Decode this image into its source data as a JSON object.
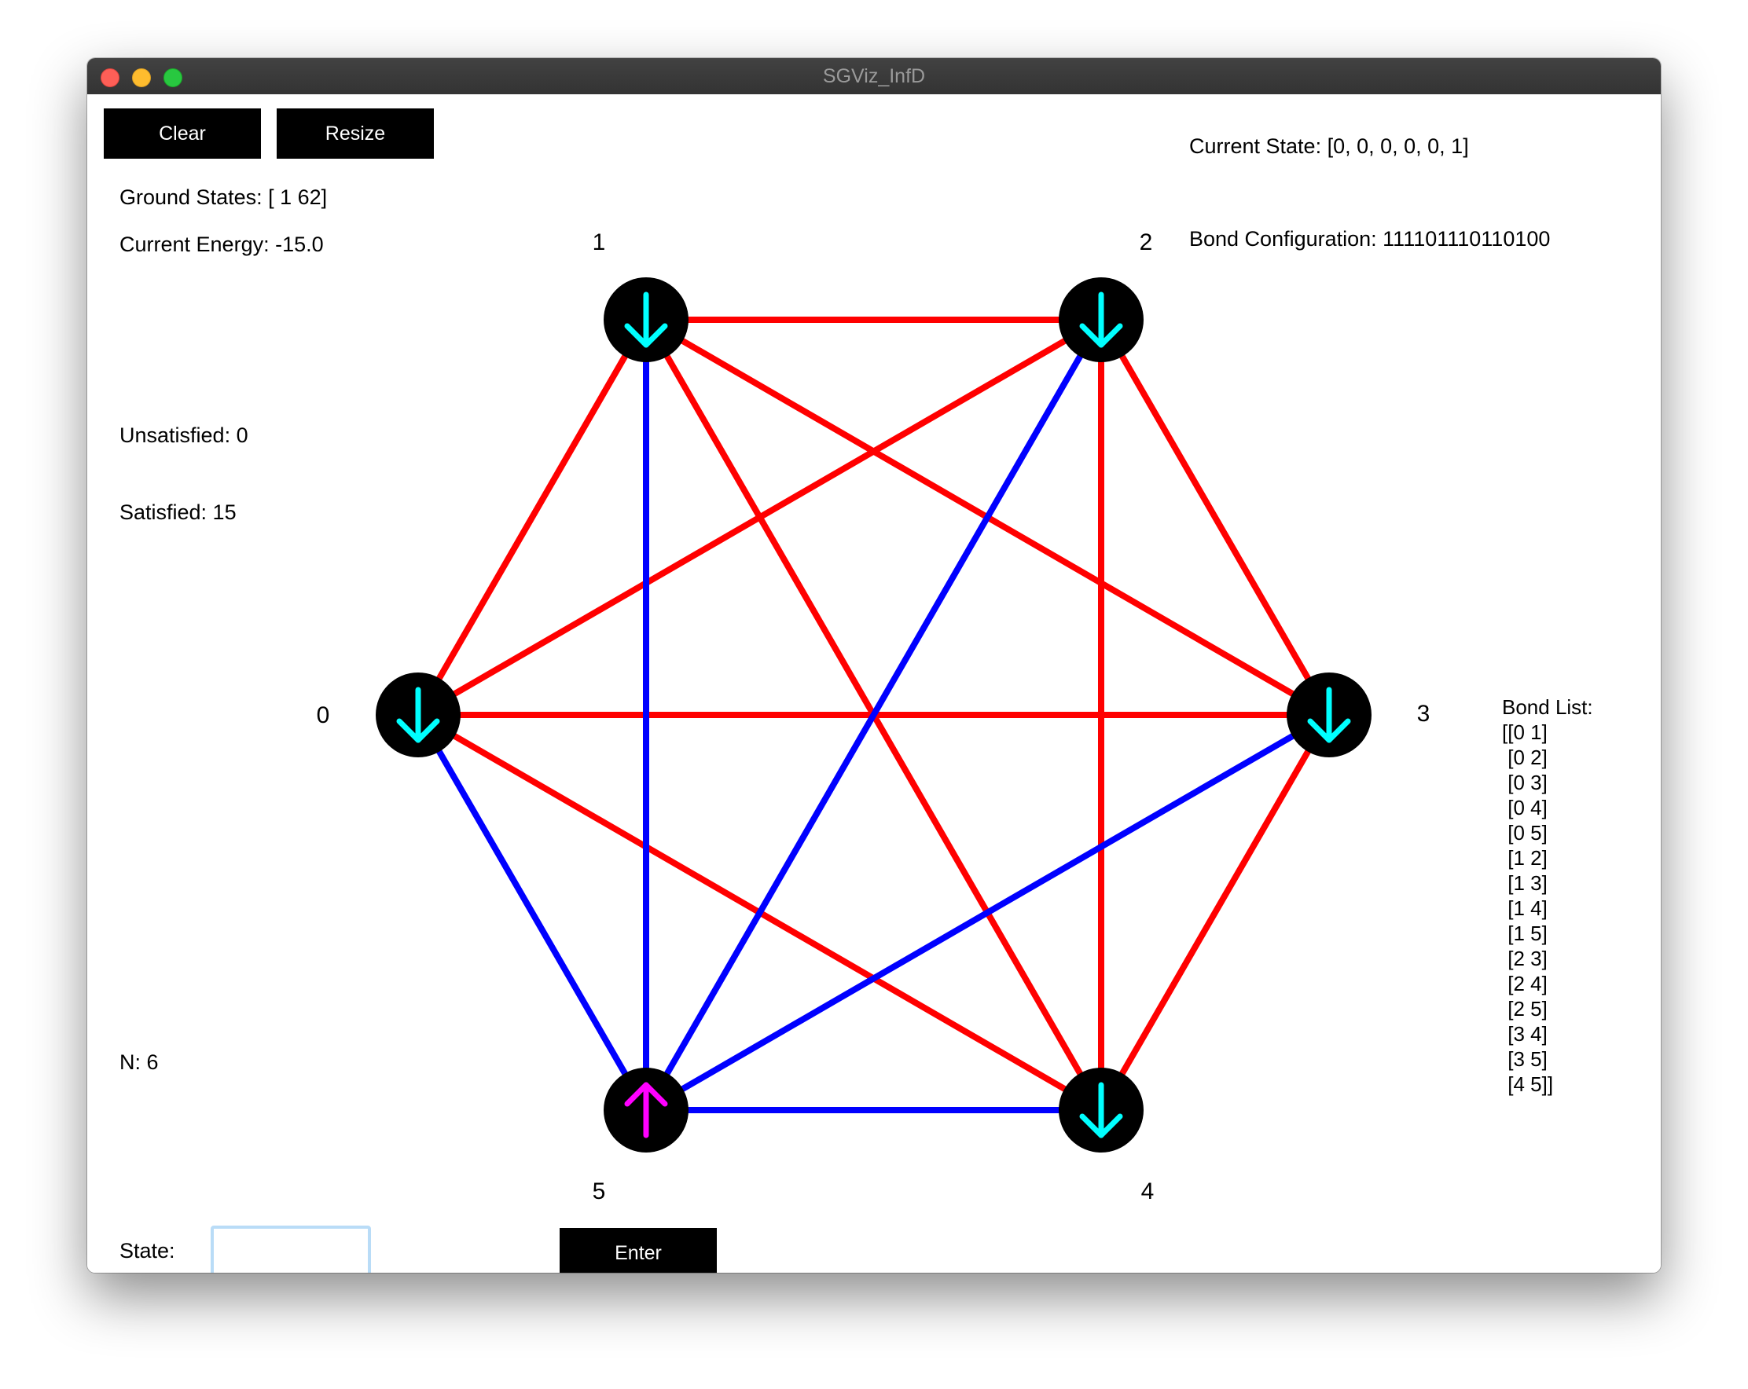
{
  "window": {
    "title": "SGViz_InfD"
  },
  "toolbar": {
    "clear_label": "Clear",
    "resize_label": "Resize",
    "enter_label": "Enter"
  },
  "info": {
    "ground_states": "Ground States: [ 1 62]",
    "current_energy": "Current Energy: -15.0",
    "unsatisfied": "Unsatisfied: 0",
    "satisfied": "Satisfied: 15",
    "n": "N: 6",
    "current_state": "Current State: [0, 0, 0, 0, 0, 1]",
    "bond_configuration": "Bond Configuration: 111101110110100"
  },
  "state_input": {
    "label": "State:",
    "value": "",
    "placeholder": ""
  },
  "bond_list": {
    "title": "Bond List:",
    "lines": [
      "[[0 1]",
      " [0 2]",
      " [0 3]",
      " [0 4]",
      " [0 5]",
      " [1 2]",
      " [1 3]",
      " [1 4]",
      " [1 5]",
      " [2 3]",
      " [2 4]",
      " [2 5]",
      " [3 4]",
      " [3 5]",
      " [4 5]]"
    ]
  },
  "colors": {
    "ferromagnetic_bond": "#ff0000",
    "antiferromagnetic_bond": "#0000ff",
    "spin_down_arrow": "#00ffff",
    "spin_up_arrow": "#ff00ff",
    "node_fill": "#000000"
  },
  "graph": {
    "nodes": [
      {
        "id": "0",
        "label": "0",
        "spin": "down"
      },
      {
        "id": "1",
        "label": "1",
        "spin": "down"
      },
      {
        "id": "2",
        "label": "2",
        "spin": "down"
      },
      {
        "id": "3",
        "label": "3",
        "spin": "down"
      },
      {
        "id": "4",
        "label": "4",
        "spin": "down"
      },
      {
        "id": "5",
        "label": "5",
        "spin": "up"
      }
    ],
    "bonds": [
      {
        "pair": [
          0,
          1
        ],
        "value": 1
      },
      {
        "pair": [
          0,
          2
        ],
        "value": 1
      },
      {
        "pair": [
          0,
          3
        ],
        "value": 1
      },
      {
        "pair": [
          0,
          4
        ],
        "value": 1
      },
      {
        "pair": [
          0,
          5
        ],
        "value": 0
      },
      {
        "pair": [
          1,
          2
        ],
        "value": 1
      },
      {
        "pair": [
          1,
          3
        ],
        "value": 1
      },
      {
        "pair": [
          1,
          4
        ],
        "value": 1
      },
      {
        "pair": [
          1,
          5
        ],
        "value": 0
      },
      {
        "pair": [
          2,
          3
        ],
        "value": 1
      },
      {
        "pair": [
          2,
          4
        ],
        "value": 1
      },
      {
        "pair": [
          2,
          5
        ],
        "value": 0
      },
      {
        "pair": [
          3,
          4
        ],
        "value": 1
      },
      {
        "pair": [
          3,
          5
        ],
        "value": 0
      },
      {
        "pair": [
          4,
          5
        ],
        "value": 0
      }
    ]
  }
}
